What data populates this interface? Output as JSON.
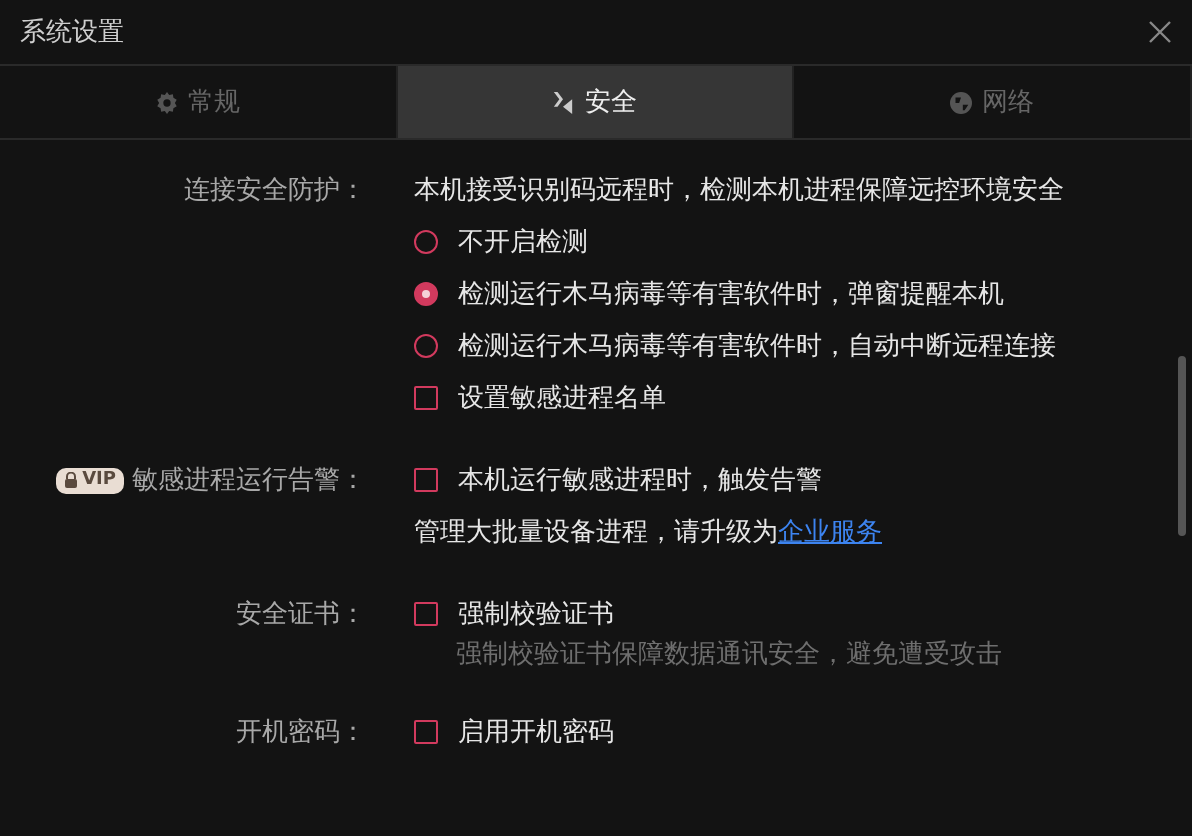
{
  "window": {
    "title": "系统设置"
  },
  "tabs": [
    {
      "label": "常规",
      "selected": false
    },
    {
      "label": "安全",
      "selected": true
    },
    {
      "label": "网络",
      "selected": false
    }
  ],
  "sections": [
    {
      "label": "连接安全防护：",
      "items": [
        {
          "kind": "text",
          "text": "本机接受识别码远程时，检测本机进程保障远控环境安全"
        },
        {
          "kind": "radio",
          "label": "不开启检测",
          "selected": false
        },
        {
          "kind": "radio",
          "label": "检测运行木马病毒等有害软件时，弹窗提醒本机",
          "selected": true
        },
        {
          "kind": "radio",
          "label": "检测运行木马病毒等有害软件时，自动中断远程连接",
          "selected": false
        },
        {
          "kind": "checkbox",
          "label": "设置敏感进程名单",
          "checked": false
        }
      ]
    },
    {
      "label": "敏感进程运行告警：",
      "badge": "VIP",
      "items": [
        {
          "kind": "checkbox",
          "label": "本机运行敏感进程时，触发告警",
          "checked": false
        },
        {
          "kind": "text",
          "text": "管理大批量设备进程，请升级为",
          "link": "企业服务"
        }
      ]
    },
    {
      "label": "安全证书：",
      "items": [
        {
          "kind": "checkbox",
          "label": "强制校验证书",
          "checked": false
        },
        {
          "kind": "hint",
          "text": "强制校验证书保障数据通讯安全，避免遭受攻击"
        }
      ]
    },
    {
      "label": "开机密码：",
      "items": [
        {
          "kind": "checkbox",
          "label": "启用开机密码",
          "checked": false
        }
      ]
    }
  ]
}
